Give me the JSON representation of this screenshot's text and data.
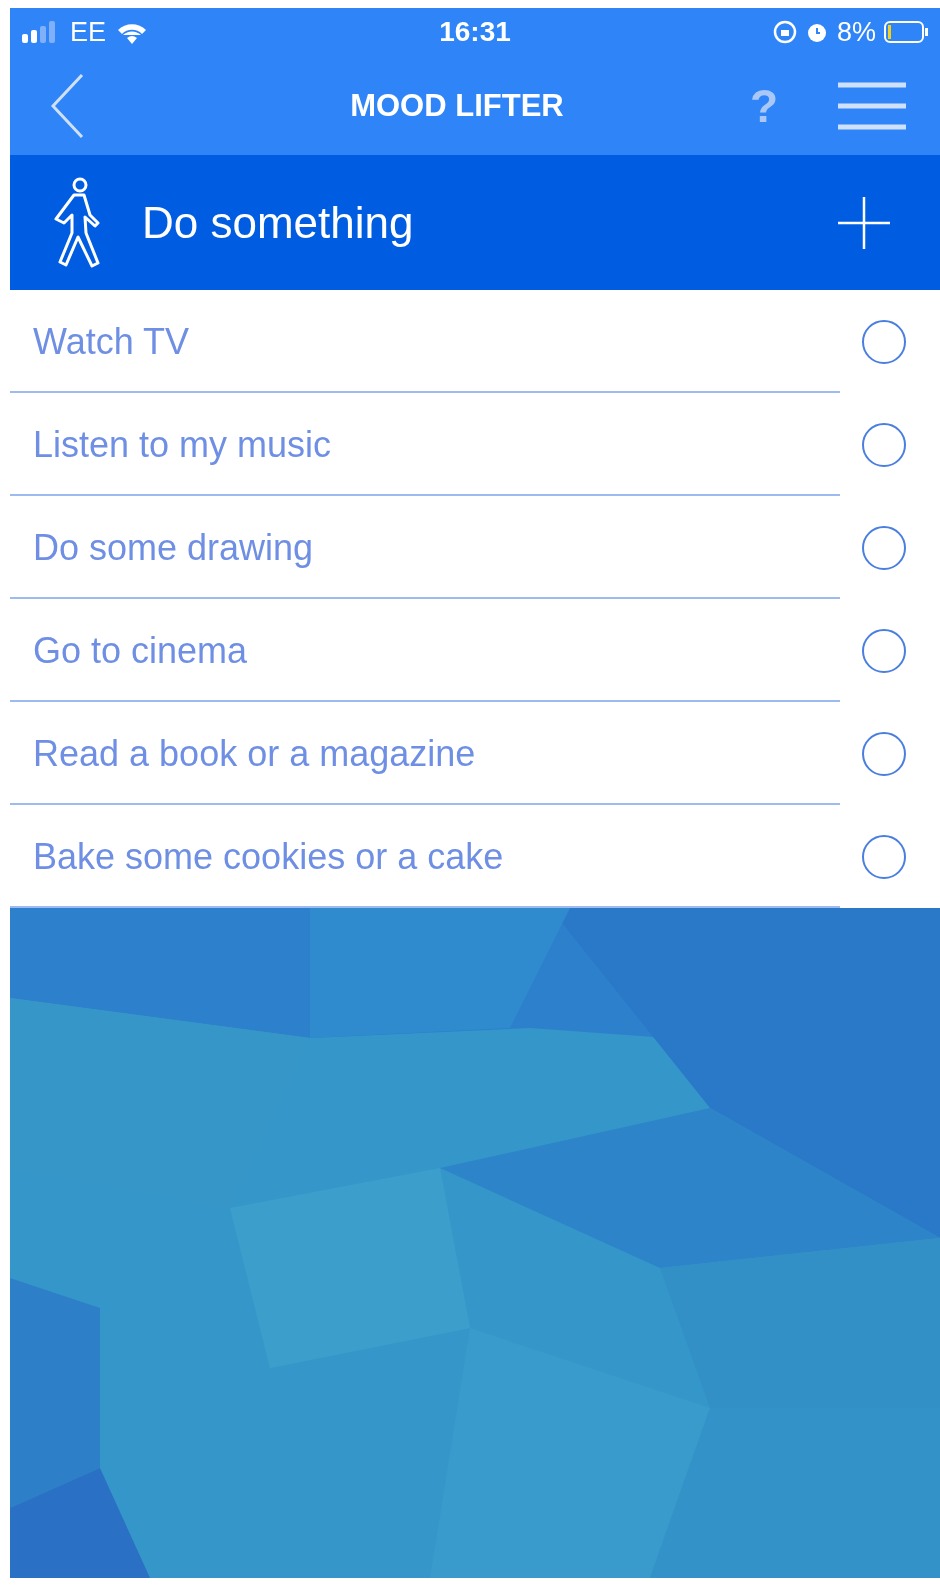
{
  "status_bar": {
    "carrier": "EE",
    "time": "16:31",
    "battery": "8%"
  },
  "nav_bar": {
    "title": "MOOD LIFTER",
    "help": "?"
  },
  "section": {
    "title": "Do something"
  },
  "items": [
    {
      "label": "Watch TV",
      "selected": false
    },
    {
      "label": "Listen to my music",
      "selected": false
    },
    {
      "label": "Do some drawing",
      "selected": false
    },
    {
      "label": "Go to cinema",
      "selected": false
    },
    {
      "label": "Read a book or a magazine",
      "selected": false
    },
    {
      "label": "Bake some cookies or a cake",
      "selected": false
    }
  ]
}
